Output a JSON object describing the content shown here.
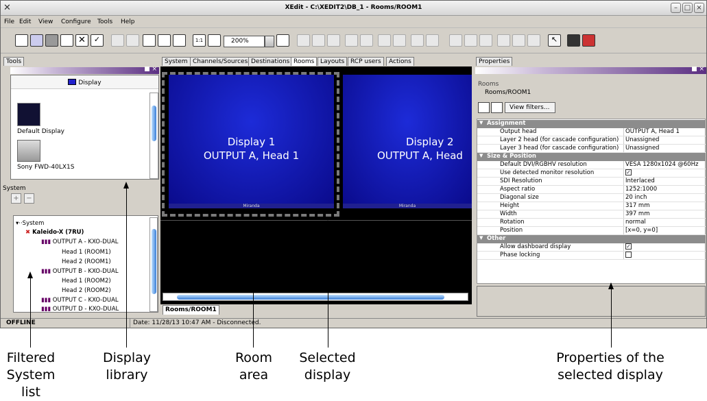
{
  "window": {
    "title": "XEdit - C:\\XEDIT2\\DB_1 - Rooms/ROOM1",
    "logo": "✕"
  },
  "menu": [
    "File",
    "Edit",
    "View",
    "Configure",
    "Tools",
    "Help"
  ],
  "toolbar": {
    "zoom": "200%"
  },
  "tools_panel": {
    "tab": "Tools",
    "display_header": "Display",
    "items": [
      "Default Display",
      "Sony FWD-40LX1S"
    ],
    "system_label": "System"
  },
  "system_tree": [
    "System",
    "Kaleido-X (7RU)",
    "OUTPUT A - KXO-DUAL",
    "Head 1 (ROOM1)",
    "Head 2 (ROOM1)",
    "OUTPUT B - KXO-DUAL",
    "Head 1 (ROOM2)",
    "Head 2 (ROOM2)",
    "OUTPUT C - KXO-DUAL",
    "OUTPUT D - KXO-DUAL"
  ],
  "center_tabs": [
    "System",
    "Channels/Sources",
    "Destinations",
    "Rooms",
    "Layouts",
    "RCP users",
    "Actions"
  ],
  "displays": [
    {
      "name": "Display 1",
      "output": "OUTPUT A, Head 1"
    },
    {
      "name": "Display 2",
      "output": "OUTPUT A, Head"
    }
  ],
  "brand": "Miranda",
  "room_tab": "Rooms/ROOM1",
  "properties": {
    "tab": "Properties",
    "breadcrumb1": "Rooms",
    "breadcrumb2": "Rooms/ROOM1",
    "filter_button": "View filters...",
    "groups": [
      {
        "name": "Assignment",
        "rows": [
          [
            "Output head",
            "OUTPUT A, Head 1"
          ],
          [
            "Layer 2 head (for cascade configuration)",
            "Unassigned"
          ],
          [
            "Layer 3 head (for cascade configuration)",
            "Unassigned"
          ]
        ]
      },
      {
        "name": "Size & Position",
        "rows": [
          [
            "Default DVI/RGBHV resolution",
            "VESA 1280x1024 @60Hz"
          ],
          [
            "Use detected monitor resolution",
            "☑"
          ],
          [
            "SDI Resolution",
            "Interlaced"
          ],
          [
            "Aspect ratio",
            "1252:1000"
          ],
          [
            "Diagonal size",
            "20 inch"
          ],
          [
            "Height",
            "317 mm"
          ],
          [
            "Width",
            "397 mm"
          ],
          [
            "Rotation",
            "normal"
          ],
          [
            "Position",
            "[x=0, y=0]"
          ]
        ]
      },
      {
        "name": "Other",
        "rows": [
          [
            "Allow dashboard display",
            "☑"
          ],
          [
            "Phase locking",
            "☐"
          ]
        ]
      }
    ]
  },
  "status": {
    "state": "OFFLINE",
    "message": "Date: 11/28/13 10:47 AM - Disconnected."
  },
  "callouts": [
    "Filtered System list",
    "Display library",
    "Room area",
    "Selected display",
    "Properties of the selected display"
  ]
}
